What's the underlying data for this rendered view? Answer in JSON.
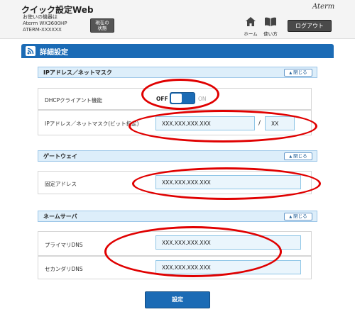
{
  "header": {
    "title": "クイック設定Web",
    "device_label": "お使いの機器は",
    "device_model": "Aterm WX3600HP",
    "device_id": "ATERM-XXXXXX",
    "current_status_label_1": "現在の",
    "current_status_label_2": "状態",
    "brand": "Aterm",
    "nav_home": "ホーム",
    "nav_manual": "使い方",
    "logout": "ログアウト"
  },
  "settings": {
    "title": "詳細設定"
  },
  "close_label": "閉じる",
  "sections": {
    "ip": {
      "title": "IPアドレス／ネットマスク",
      "dhcp_label": "DHCPクライアント機能",
      "toggle_off": "OFF",
      "toggle_on": "ON",
      "ipmask_label": "IPアドレス／ネットマスク(ビット指定)",
      "ip_value": "XXX.XXX.XXX.XXX",
      "slash": "/",
      "mask_value": "XX"
    },
    "gateway": {
      "title": "ゲートウェイ",
      "fixed_label": "固定アドレス",
      "fixed_value": "XXX.XXX.XXX.XXX"
    },
    "dns": {
      "title": "ネームサーバ",
      "primary_label": "プライマリDNS",
      "primary_value": "XXX.XXX.XXX.XXX",
      "secondary_label": "セカンダリDNS",
      "secondary_value": "XXX.XXX.XXX.XXX"
    }
  },
  "submit_label": "設定",
  "colors": {
    "accent": "#1b6bb5",
    "annotation": "#e00000"
  }
}
